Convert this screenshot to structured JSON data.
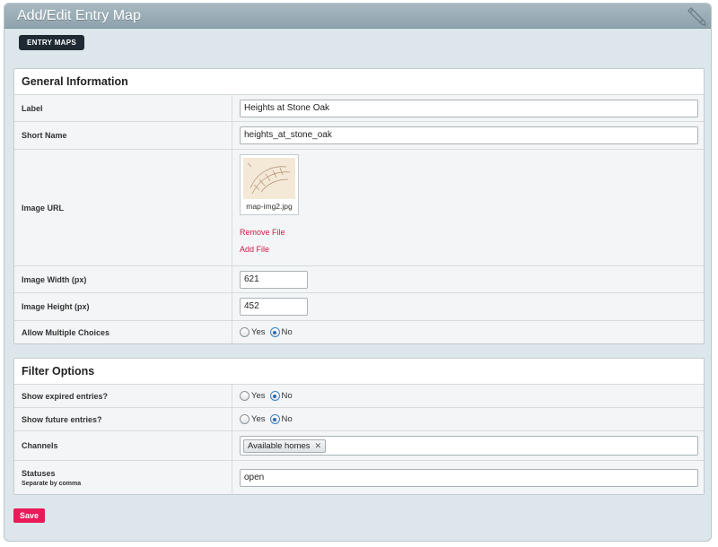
{
  "header": {
    "title": "Add/Edit Entry Map",
    "icon": "pencil-icon"
  },
  "tabs": [
    {
      "label": "ENTRY MAPS"
    }
  ],
  "general": {
    "heading": "General Information",
    "label": {
      "label": "Label",
      "value": "Heights at Stone Oak"
    },
    "short_name": {
      "label": "Short Name",
      "value": "heights_at_stone_oak"
    },
    "image_url": {
      "label": "Image URL",
      "file_name": "map-img2.jpg",
      "remove_label": "Remove File",
      "add_label": "Add File"
    },
    "image_width": {
      "label": "Image Width (px)",
      "value": "621"
    },
    "image_height": {
      "label": "Image Height (px)",
      "value": "452"
    },
    "allow_multiple": {
      "label": "Allow Multiple Choices",
      "yes": "Yes",
      "no": "No",
      "selected": "No"
    }
  },
  "filter": {
    "heading": "Filter Options",
    "show_expired": {
      "label": "Show expired entries?",
      "yes": "Yes",
      "no": "No",
      "selected": "No"
    },
    "show_future": {
      "label": "Show future entries?",
      "yes": "Yes",
      "no": "No",
      "selected": "No"
    },
    "channels": {
      "label": "Channels",
      "tags": [
        "Available homes"
      ]
    },
    "statuses": {
      "label": "Statuses",
      "hint": "Separate by comma",
      "value": "open"
    }
  },
  "save_label": "Save",
  "colors": {
    "accent": "#e81a5a",
    "link": "#d6174c",
    "tab_bg": "#1f2a33",
    "radio_selected": "#2d6fb3"
  }
}
